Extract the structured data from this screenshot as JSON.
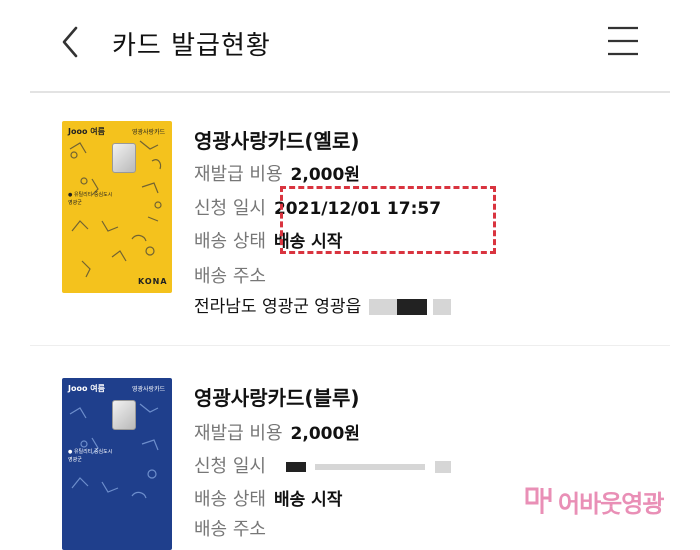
{
  "header": {
    "title": "카드 발급현황",
    "back_icon": "chevron-left-icon",
    "menu_icon": "hamburger-menu-icon"
  },
  "cards": [
    {
      "name": "영광사랑카드(옐로)",
      "card_brand": "Jooo 여름",
      "card_label": "영광사랑카드",
      "card_slogan_1": "● 유틸리티 중심도시",
      "card_slogan_2": "영광군",
      "card_logo": "KONA",
      "fee_label": "재발급 비용",
      "fee_value": "2,000원",
      "date_label": "신청 일시",
      "date_value": "2021/12/01 17:57",
      "status_label": "배송 상태",
      "status_value": "배송 시작",
      "address_label": "배송 주소",
      "address_value": "전라남도 영광군 영광읍",
      "color": "#f4c21d"
    },
    {
      "name": "영광사랑카드(블루)",
      "card_brand": "Jooo 여름",
      "card_label": "영광사랑카드",
      "card_slogan_1": "● 유틸리티 중심도시",
      "card_slogan_2": "영광군",
      "fee_label": "재발급 비용",
      "fee_value": "2,000원",
      "date_label": "신청 일시",
      "status_label": "배송 상태",
      "status_value": "배송 시작",
      "address_label": "배송 주소",
      "color": "#1f3f8c"
    }
  ],
  "watermark": {
    "text": "어바웃영광",
    "color": "#e98fb6"
  }
}
